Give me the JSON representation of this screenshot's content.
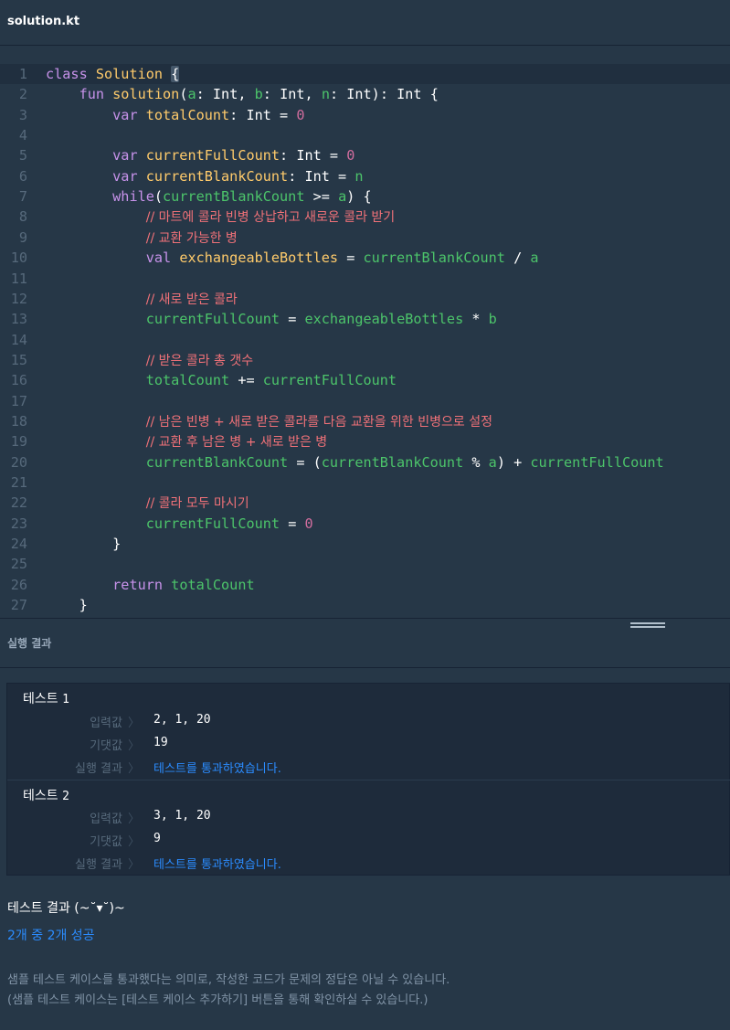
{
  "file": {
    "title": "solution.kt"
  },
  "editor": {
    "lines": [
      {
        "n": "1",
        "tokens": [
          [
            "kw",
            "class "
          ],
          [
            "fn",
            "Solution "
          ],
          [
            "brk",
            "{"
          ]
        ]
      },
      {
        "n": "2",
        "tokens": [
          [
            "pl",
            "    "
          ],
          [
            "kw",
            "fun "
          ],
          [
            "fn",
            "solution"
          ],
          [
            "pl",
            "("
          ],
          [
            "va",
            "a"
          ],
          [
            "pl",
            ": Int, "
          ],
          [
            "va",
            "b"
          ],
          [
            "pl",
            ": Int, "
          ],
          [
            "va",
            "n"
          ],
          [
            "pl",
            ": Int): Int {"
          ]
        ]
      },
      {
        "n": "3",
        "tokens": [
          [
            "pl",
            "        "
          ],
          [
            "kw",
            "var "
          ],
          [
            "id",
            "totalCount"
          ],
          [
            "pl",
            ": Int = "
          ],
          [
            "num",
            "0"
          ]
        ]
      },
      {
        "n": "4",
        "tokens": []
      },
      {
        "n": "5",
        "tokens": [
          [
            "pl",
            "        "
          ],
          [
            "kw",
            "var "
          ],
          [
            "id",
            "currentFullCount"
          ],
          [
            "pl",
            ": Int = "
          ],
          [
            "num",
            "0"
          ]
        ]
      },
      {
        "n": "6",
        "tokens": [
          [
            "pl",
            "        "
          ],
          [
            "kw",
            "var "
          ],
          [
            "id",
            "currentBlankCount"
          ],
          [
            "pl",
            ": Int = "
          ],
          [
            "va",
            "n"
          ]
        ]
      },
      {
        "n": "7",
        "tokens": [
          [
            "pl",
            "        "
          ],
          [
            "kw",
            "while"
          ],
          [
            "pl",
            "("
          ],
          [
            "va",
            "currentBlankCount"
          ],
          [
            "pl",
            " >= "
          ],
          [
            "va",
            "a"
          ],
          [
            "pl",
            ") {"
          ]
        ]
      },
      {
        "n": "8",
        "tokens": [
          [
            "pl",
            "            "
          ],
          [
            "cm",
            "// 마트에 콜라 빈병 상납하고 새로운 콜라 받기"
          ]
        ]
      },
      {
        "n": "9",
        "tokens": [
          [
            "pl",
            "            "
          ],
          [
            "cm",
            "// 교환 가능한 병"
          ]
        ]
      },
      {
        "n": "10",
        "tokens": [
          [
            "pl",
            "            "
          ],
          [
            "kw",
            "val "
          ],
          [
            "id",
            "exchangeableBottles"
          ],
          [
            "pl",
            " = "
          ],
          [
            "va",
            "currentBlankCount"
          ],
          [
            "pl",
            " / "
          ],
          [
            "va",
            "a"
          ]
        ]
      },
      {
        "n": "11",
        "tokens": []
      },
      {
        "n": "12",
        "tokens": [
          [
            "pl",
            "            "
          ],
          [
            "cm",
            "// 새로 받은 콜라"
          ]
        ]
      },
      {
        "n": "13",
        "tokens": [
          [
            "pl",
            "            "
          ],
          [
            "va",
            "currentFullCount"
          ],
          [
            "pl",
            " = "
          ],
          [
            "va",
            "exchangeableBottles"
          ],
          [
            "pl",
            " * "
          ],
          [
            "va",
            "b"
          ]
        ]
      },
      {
        "n": "14",
        "tokens": []
      },
      {
        "n": "15",
        "tokens": [
          [
            "pl",
            "            "
          ],
          [
            "cm",
            "// 받은 콜라 총 갯수"
          ]
        ]
      },
      {
        "n": "16",
        "tokens": [
          [
            "pl",
            "            "
          ],
          [
            "va",
            "totalCount"
          ],
          [
            "pl",
            " += "
          ],
          [
            "va",
            "currentFullCount"
          ]
        ]
      },
      {
        "n": "17",
        "tokens": []
      },
      {
        "n": "18",
        "tokens": [
          [
            "pl",
            "            "
          ],
          [
            "cm",
            "// 남은 빈병 + 새로 받은 콜라를 다음 교환을 위한 빈병으로 설정"
          ]
        ]
      },
      {
        "n": "19",
        "tokens": [
          [
            "pl",
            "            "
          ],
          [
            "cm",
            "// 교환 후 남은 병 + 새로 받은 병"
          ]
        ]
      },
      {
        "n": "20",
        "tokens": [
          [
            "pl",
            "            "
          ],
          [
            "va",
            "currentBlankCount"
          ],
          [
            "pl",
            " = ("
          ],
          [
            "va",
            "currentBlankCount"
          ],
          [
            "pl",
            " % "
          ],
          [
            "va",
            "a"
          ],
          [
            "pl",
            ") + "
          ],
          [
            "va",
            "currentFullCount"
          ]
        ]
      },
      {
        "n": "21",
        "tokens": []
      },
      {
        "n": "22",
        "tokens": [
          [
            "pl",
            "            "
          ],
          [
            "cm",
            "// 콜라 모두 마시기"
          ]
        ]
      },
      {
        "n": "23",
        "tokens": [
          [
            "pl",
            "            "
          ],
          [
            "va",
            "currentFullCount"
          ],
          [
            "pl",
            " = "
          ],
          [
            "num",
            "0"
          ]
        ]
      },
      {
        "n": "24",
        "tokens": [
          [
            "pl",
            "        }"
          ]
        ]
      },
      {
        "n": "25",
        "tokens": []
      },
      {
        "n": "26",
        "tokens": [
          [
            "pl",
            "        "
          ],
          [
            "kw",
            "return "
          ],
          [
            "va",
            "totalCount"
          ]
        ]
      },
      {
        "n": "27",
        "tokens": [
          [
            "pl",
            "    }"
          ]
        ]
      }
    ]
  },
  "result": {
    "title": "실행 결과"
  },
  "tests": [
    {
      "title": "테스트",
      "num": "1",
      "input_label": "입력값",
      "input": "2, 1, 20",
      "expected_label": "기댓값",
      "expected": "19",
      "result_label": "실행 결과",
      "result": "테스트를 통과하였습니다."
    },
    {
      "title": "테스트",
      "num": "2",
      "input_label": "입력값",
      "input": "3, 1, 20",
      "expected_label": "기댓값",
      "expected": "9",
      "result_label": "실행 결과",
      "result": "테스트를 통과하였습니다."
    }
  ],
  "summary": {
    "title": "테스트 결과 (~˘▾˘)~",
    "count": "2개 중 2개 성공",
    "note1": "샘플 테스트 케이스를 통과했다는 의미로, 작성한 코드가 문제의 정답은 아닐 수 있습니다.",
    "note2": "(샘플 테스트 케이스는 [테스트 케이스 추가하기] 버튼을 통해 확인하실 수 있습니다.)"
  },
  "colors": {
    "background": "#263747",
    "pass": "#2b8cff",
    "keyword": "#c792ea",
    "variable": "#4cc46a",
    "number": "#d16d9e",
    "comment": "#f07178"
  }
}
